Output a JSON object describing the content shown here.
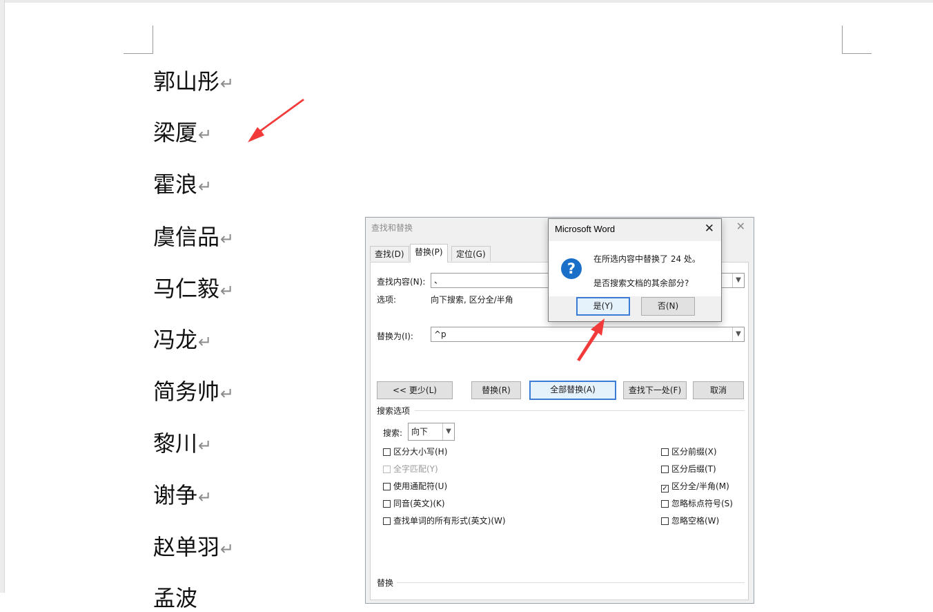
{
  "document": {
    "lines": [
      "郭山彤",
      "梁厦",
      "霍浪",
      "虞信品",
      "马仁毅",
      "冯龙",
      "简务帅",
      "黎川",
      "谢争",
      "赵单羽",
      "孟波"
    ],
    "paragraph_mark": "↵"
  },
  "find_replace": {
    "title": "查找和替换",
    "close_glyph": "✕",
    "tabs": [
      {
        "label": "查找(D)"
      },
      {
        "label": "替换(P)"
      },
      {
        "label": "定位(G)"
      }
    ],
    "find_label": "查找内容(N):",
    "find_value": "、",
    "options_label": "选项:",
    "options_value": "向下搜索, 区分全/半角",
    "replace_label": "替换为(I):",
    "replace_value": "^p",
    "buttons": {
      "less": "<< 更少(L)",
      "replace": "替换(R)",
      "replace_all": "全部替换(A)",
      "find_next": "查找下一处(F)",
      "cancel": "取消"
    },
    "search_options_title": "搜索选项",
    "search_label": "搜索:",
    "search_value": "向下",
    "checks_left": [
      {
        "label": "区分大小写(H)",
        "checked": false,
        "disabled": false
      },
      {
        "label": "全字匹配(Y)",
        "checked": false,
        "disabled": true
      },
      {
        "label": "使用通配符(U)",
        "checked": false,
        "disabled": false
      },
      {
        "label": "同音(英文)(K)",
        "checked": false,
        "disabled": false
      },
      {
        "label": "查找单词的所有形式(英文)(W)",
        "checked": false,
        "disabled": false
      }
    ],
    "checks_right": [
      {
        "label": "区分前缀(X)",
        "checked": false
      },
      {
        "label": "区分后缀(T)",
        "checked": false
      },
      {
        "label": "区分全/半角(M)",
        "checked": true
      },
      {
        "label": "忽略标点符号(S)",
        "checked": false
      },
      {
        "label": "忽略空格(W)",
        "checked": false
      }
    ],
    "replace_section_title": "替换"
  },
  "message_box": {
    "title": "Microsoft Word",
    "close_glyph": "✕",
    "icon_glyph": "?",
    "line1": "在所选内容中替换了 24 处。",
    "line2": "是否搜索文档的其余部分?",
    "yes": "是(Y)",
    "no": "否(N)"
  },
  "colors": {
    "annotation_arrow": "#f23a3a",
    "question_icon": "#1a6fc9",
    "focus_border": "#3a7bd5"
  }
}
